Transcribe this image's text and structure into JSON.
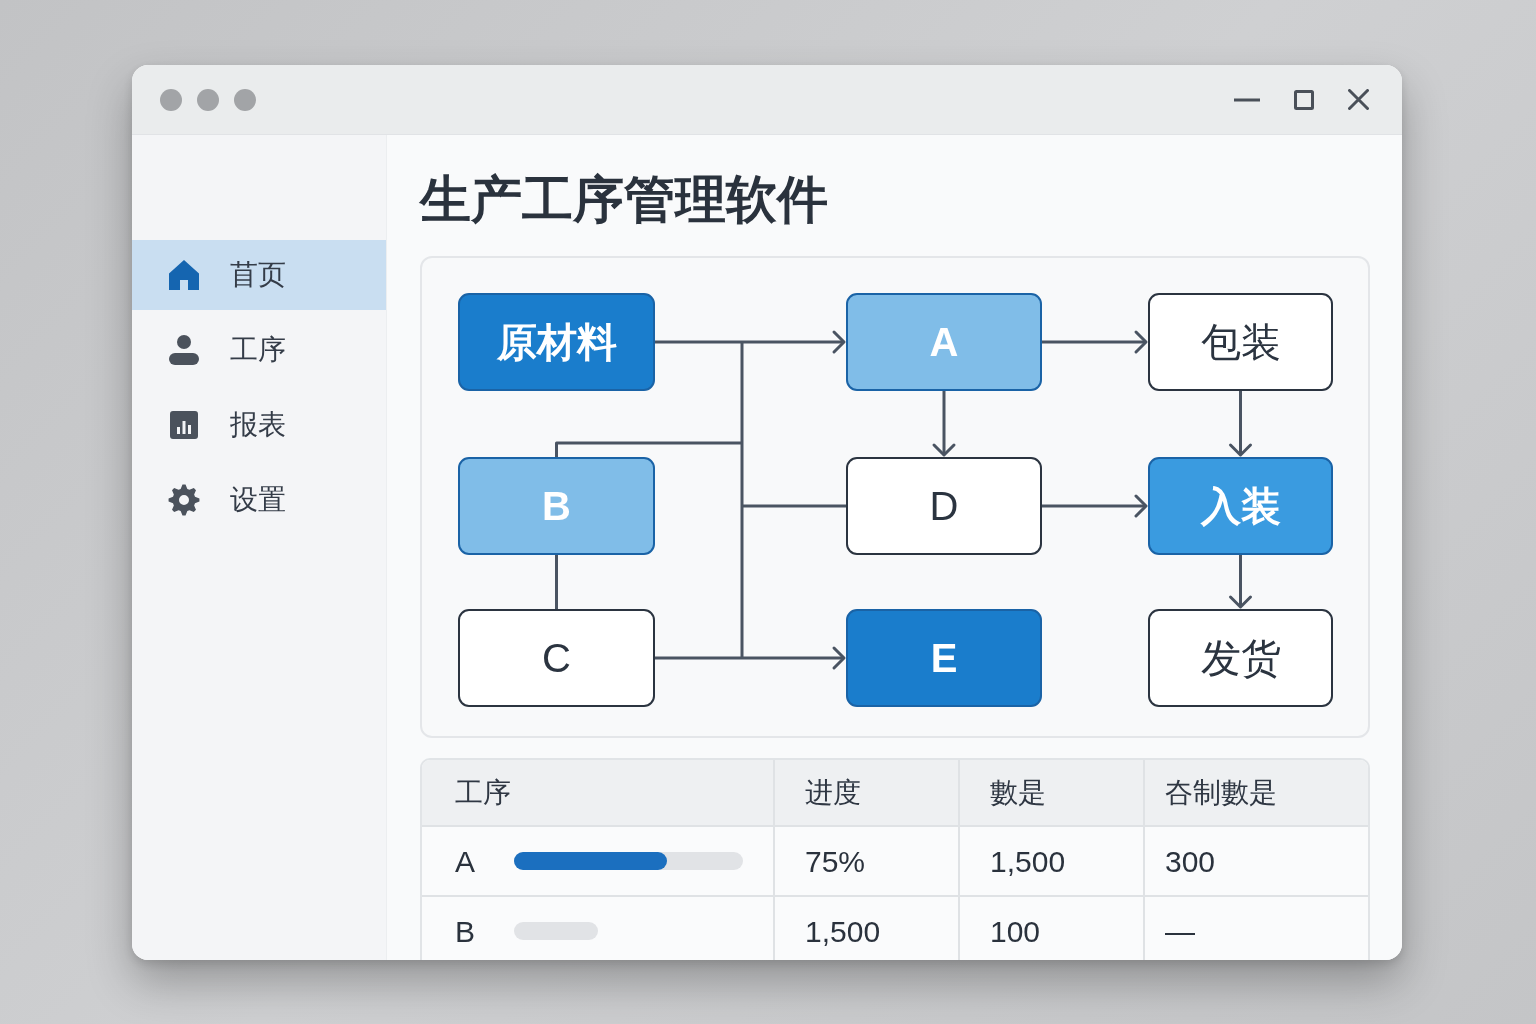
{
  "sidebar": {
    "items": [
      {
        "label": "苜页",
        "selected": true
      },
      {
        "label": "工序",
        "selected": false
      },
      {
        "label": "报表",
        "selected": false
      },
      {
        "label": "设置",
        "selected": false
      }
    ]
  },
  "title": "生产工序管理软件",
  "flowchart": {
    "rows": [
      [
        {
          "label": "原材料",
          "color": "#1a7dcc"
        },
        {
          "label": "A",
          "color": "#80bde8"
        },
        {
          "label": "包装",
          "color": "#ffffff"
        }
      ],
      [
        {
          "label": "B",
          "color": "#80bde8"
        },
        {
          "label": "D",
          "color": "#ffffff"
        },
        {
          "label": "入装",
          "color": "#3a9be0"
        }
      ],
      [
        {
          "label": "C",
          "color": "#ffffff"
        },
        {
          "label": "E",
          "color": "#1a7dcc"
        },
        {
          "label": "发货",
          "color": "#ffffff"
        }
      ]
    ]
  },
  "table": {
    "columns": [
      "工序",
      "进度",
      "數是",
      "夻制數是"
    ],
    "rows": [
      {
        "cells": [
          "A",
          "75%",
          "1,500",
          "300"
        ],
        "progress": {
          "kind": "meter",
          "level": 0.67
        }
      },
      {
        "cells": [
          "B",
          "1,500",
          "100",
          "—"
        ],
        "progress": {
          "kind": "placeholder"
        }
      }
    ]
  }
}
